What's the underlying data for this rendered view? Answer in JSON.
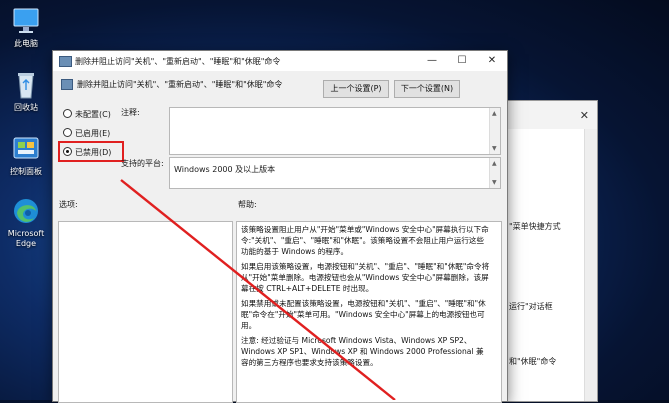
{
  "desktop": {
    "icons": [
      {
        "label": "此电脑",
        "icon": "monitor-icon"
      },
      {
        "label": "回收站",
        "icon": "recycle-bin-icon"
      },
      {
        "label": "控制面板",
        "icon": "control-panel-icon"
      },
      {
        "label": "Microsoft Edge",
        "icon": "edge-icon"
      }
    ]
  },
  "background_window": {
    "lines": [
      "\"菜单快捷方式",
      "运行\"对话框",
      "和\"休眠\"命令"
    ]
  },
  "dialog": {
    "title": "删除并阻止访问\"关机\"、\"重新启动\"、\"睡眠\"和\"休眠\"命令",
    "header": "删除并阻止访问\"关机\"、\"重新启动\"、\"睡眠\"和\"休眠\"命令",
    "prev_button": "上一个设置(P)",
    "next_button": "下一个设置(N)",
    "options": {
      "not_configured": "未配置(C)",
      "enabled": "已启用(E)",
      "disabled": "已禁用(D)",
      "selected": "disabled"
    },
    "comment_label": "注释:",
    "supported_label": "支持的平台:",
    "supported_value": "Windows 2000 及以上版本",
    "options_label": "选项:",
    "help_label": "帮助:",
    "help_paragraphs": [
      "该策略设置阻止用户从\"开始\"菜单或\"Windows 安全中心\"屏幕执行以下命令:\"关机\"、\"重启\"、\"睡眠\"和\"休眠\"。该策略设置不会阻止用户运行这些功能的基于 Windows 的程序。",
      "如果启用该策略设置，电源按钮和\"关机\"、\"重启\"、\"睡眠\"和\"休眠\"命令将从\"开始\"菜单删除。电源按钮也会从\"Windows 安全中心\"屏幕删除，该屏幕在按 CTRL+ALT+DELETE 时出现。",
      "如果禁用或未配置该策略设置，电源按钮和\"关机\"、\"重启\"、\"睡眠\"和\"休眠\"命令在\"开始\"菜单可用。\"Windows 安全中心\"屏幕上的电源按钮也可用。",
      "注意: 经过验证与 Microsoft Windows Vista、Windows XP SP2、Windows XP SP1、Windows XP 和 Windows 2000 Professional 兼容的第三方程序也要求支持该策略设置。"
    ]
  },
  "colors": {
    "highlight": "#e02020"
  }
}
